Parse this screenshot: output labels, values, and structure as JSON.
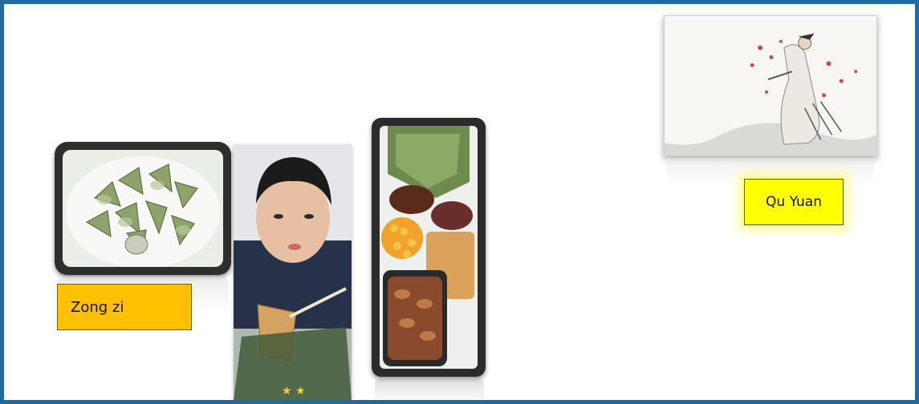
{
  "slide": {
    "border_color": "#1f6aa0",
    "images": [
      {
        "name": "zongzi-photo",
        "subject": "plate of wrapped zongzi dumplings"
      },
      {
        "name": "boy-photo",
        "subject": "boy eating a zongzi"
      },
      {
        "name": "food-tray-photo",
        "subject": "trays of zongzi ingredients"
      },
      {
        "name": "qu-yuan-painting",
        "subject": "ink painting of Qu Yuan"
      }
    ],
    "labels": {
      "zongzi": "Zong zi",
      "quyuan": "Qu Yuan"
    },
    "colors": {
      "zongzi_label_bg": "#ffc000",
      "quyuan_label_bg": "#ffff00"
    }
  }
}
